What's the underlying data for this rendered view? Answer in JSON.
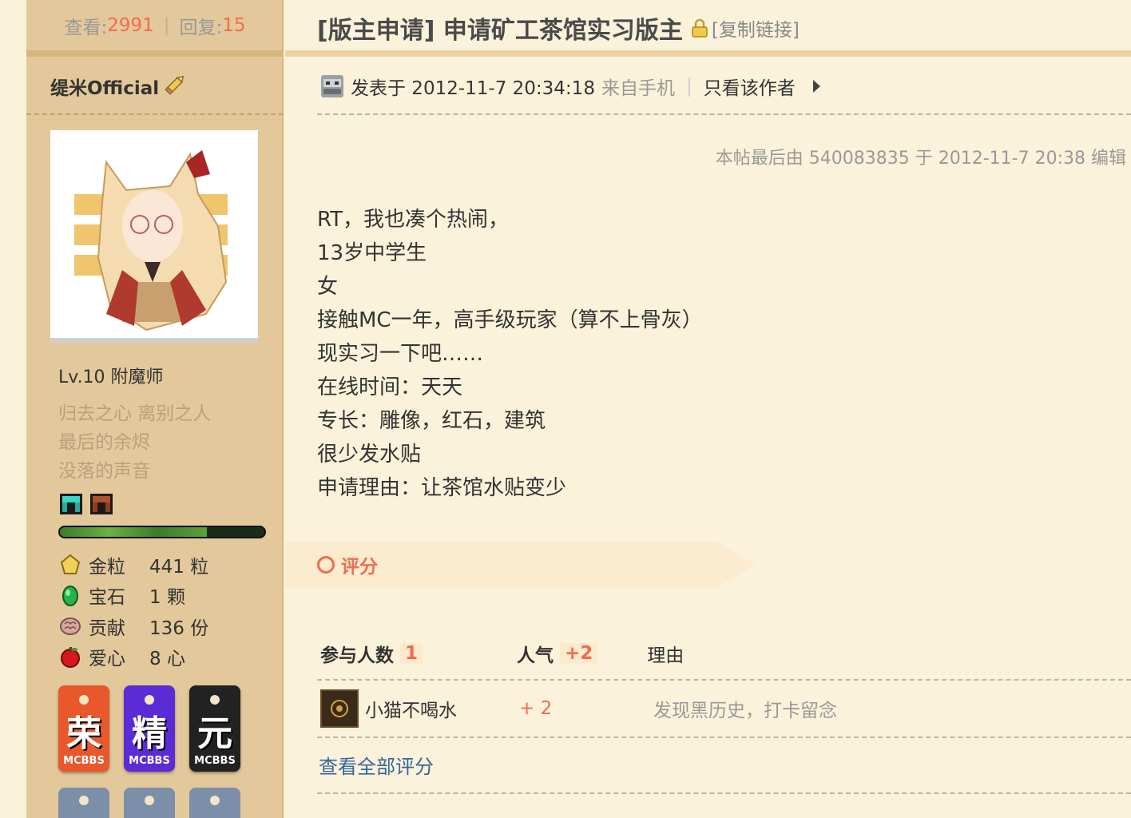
{
  "thread": {
    "views_label": "查看:",
    "views": "2991",
    "replies_label": "回复:",
    "replies": "15",
    "title": "[版主申请] 申请矿工茶馆实习版主",
    "copy_link": "[复制链接]"
  },
  "author": {
    "name": "缇米Official",
    "level": "Lv.10 附魔师",
    "motto": [
      "归去之心 离别之人",
      "最后的余烬",
      "没落的声音"
    ],
    "xp_fraction": 0.72,
    "currencies": [
      {
        "name": "金粒",
        "value": "441 粒",
        "icon": "gold-nugget-icon"
      },
      {
        "name": "宝石",
        "value": "1 颗",
        "icon": "emerald-icon"
      },
      {
        "name": "贡献",
        "value": "136 份",
        "icon": "brain-icon"
      },
      {
        "name": "爱心",
        "value": "8 心",
        "icon": "apple-icon"
      }
    ],
    "medals": [
      {
        "char": "荣",
        "tag": "MCBBS",
        "color": "#e8582a"
      },
      {
        "char": "精",
        "tag": "MCBBS",
        "color": "#5b2bd6"
      },
      {
        "char": "元",
        "tag": "MCBBS",
        "color": "#222222"
      }
    ]
  },
  "post": {
    "meta_prefix": "发表于 2012-11-7 20:34:18",
    "meta_source": "来自手机",
    "only_author": "只看该作者",
    "edit_note": "本帖最后由 540083835 于 2012-11-7 20:38 编辑",
    "lines": [
      "RT，我也凑个热闹，",
      "13岁中学生",
      "女",
      "接触MC一年，高手级玩家（算不上骨灰）",
      "现实习一下吧……",
      "在线时间：天天",
      "专长：雕像，红石，建筑",
      "很少发水贴",
      "申请理由：让茶馆水贴变少"
    ]
  },
  "rating": {
    "title": "评分",
    "participants_label": "参与人数",
    "participants": "1",
    "popularity_label": "人气",
    "popularity": "+2",
    "reason_label": "理由",
    "row": {
      "user": "小猫不喝水",
      "score": "+ 2",
      "reason": "发现黑历史，打卡留念"
    },
    "view_all": "查看全部评分"
  }
}
